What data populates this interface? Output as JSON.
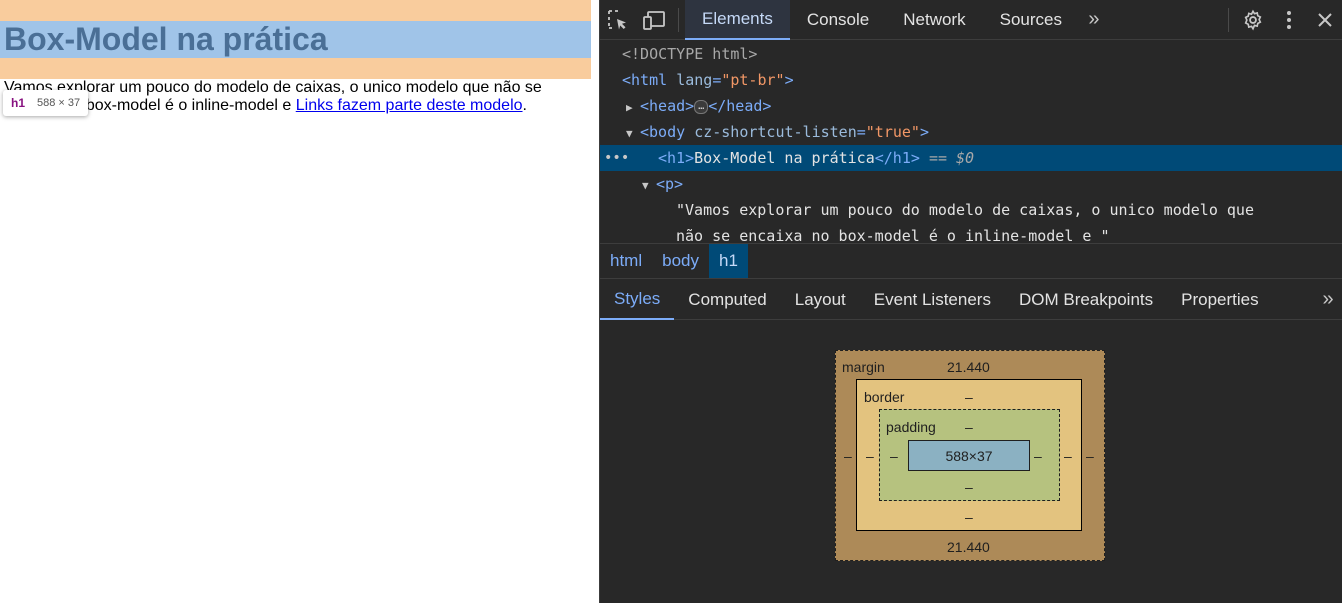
{
  "page": {
    "heading": "Box-Model na prática",
    "paragraph_start": "Vamos explorar um pouco do modelo de caixas, o unico modelo que não se encaixa no box-model é o inline-model e ",
    "link_text": "Links fazem parte deste modelo",
    "paragraph_end": ".",
    "tooltip_tag": "h1",
    "tooltip_size": "588 × 37"
  },
  "devtools": {
    "tabs": [
      {
        "label": "Elements",
        "active": true
      },
      {
        "label": "Console"
      },
      {
        "label": "Network"
      },
      {
        "label": "Sources"
      }
    ],
    "dom": {
      "doctype": "<!DOCTYPE html>",
      "html_open": "<html",
      "html_attr": "lang",
      "html_val": "\"pt-br\"",
      "html_close": ">",
      "head_open": "<head>",
      "head_ellipsis": "…",
      "head_close": "</head>",
      "body_open": "<body",
      "body_attr": "cz-shortcut-listen",
      "body_val": "\"true\"",
      "body_close": ">",
      "h1_open": "<h1>",
      "h1_text": "Box-Model na prática",
      "h1_close": "</h1>",
      "h1_ref": "== $0",
      "p_open": "<p>",
      "p_text_1": "\"Vamos explorar um pouco do modelo de caixas, o unico modelo que",
      "p_text_2": "não se encaixa no box-model é o inline-model e \""
    },
    "breadcrumbs": [
      {
        "label": "html"
      },
      {
        "label": "body"
      },
      {
        "label": "h1",
        "active": true
      }
    ],
    "subtabs": [
      {
        "label": "Styles",
        "active": true
      },
      {
        "label": "Computed"
      },
      {
        "label": "Layout"
      },
      {
        "label": "Event Listeners"
      },
      {
        "label": "DOM Breakpoints"
      },
      {
        "label": "Properties"
      }
    ],
    "box_model": {
      "margin_label": "margin",
      "margin_top": "21.440",
      "margin_bottom": "21.440",
      "margin_left": "–",
      "margin_right": "–",
      "border_label": "border",
      "border_top": "–",
      "border_bottom": "–",
      "border_left": "–",
      "border_right": "–",
      "padding_label": "padding",
      "padding_top": "–",
      "padding_bottom": "–",
      "padding_left": "–",
      "padding_right": "–",
      "content": "588×37"
    },
    "colors": {
      "accent": "#7cacf8",
      "selected_row": "#004a77",
      "margin_highlight": "#f9cc9d",
      "content_highlight": "#a0c4e8"
    }
  }
}
